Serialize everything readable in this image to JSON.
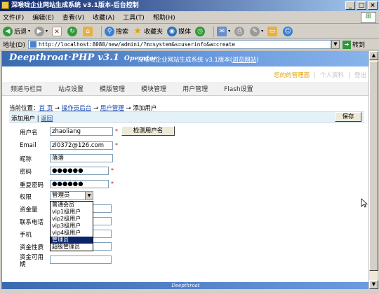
{
  "window": {
    "title": "深喉咙企业网站生成系统 v3.1版本-后台控制"
  },
  "menubar": [
    "文件(F)",
    "编辑(E)",
    "查看(V)",
    "收藏(A)",
    "工具(T)",
    "帮助(H)"
  ],
  "toolbar": {
    "back": "后退",
    "search": "搜索",
    "favorites": "收藏夹",
    "media": "媒体"
  },
  "address": {
    "label": "地址(D)",
    "url": "http://localhost:8080/new/admini/?m=system&s=userinfo&a=create",
    "go": "转到"
  },
  "app": {
    "logo": "Deepthroat·PHP v3.1",
    "logo_suffix": "Operator",
    "subtitle": "深喉咙企业网站生成系统 v3.1版本",
    "browse_site": "浏览网站",
    "user_links": [
      "您的的管理面",
      "个人资料",
      "登出"
    ]
  },
  "nav_tabs": [
    "频道与栏目",
    "站点设置",
    "模版管理",
    "模块管理",
    "用户管理",
    "Flash设置"
  ],
  "breadcrumb": {
    "prefix": "当前位置：",
    "home": "首 页",
    "arrow": "→",
    "backend": "操作员后台",
    "user_mgmt": "用户管理",
    "current": "添加用户"
  },
  "panel": {
    "title": "添加用户",
    "back": "返回",
    "save": "保存"
  },
  "form": {
    "username": {
      "label": "用户名",
      "value": "zhaoliang"
    },
    "check_button": "检测用户名",
    "email": {
      "label": "Email",
      "value": "zl0372@126.com"
    },
    "nickname": {
      "label": "昵称",
      "value": "落落"
    },
    "password": {
      "label": "密码",
      "value": "●●●●●●"
    },
    "repeat_password": {
      "label": "重复密码",
      "value": "●●●●●●"
    },
    "permission": {
      "label": "权限",
      "value": "管理员"
    },
    "capital": {
      "label": "资金量"
    },
    "phone": {
      "label": "联系电话"
    },
    "mobile": {
      "label": "手机"
    },
    "capital_type": {
      "label": "资金性质"
    },
    "capital_period": {
      "label": "资金可用期"
    },
    "required_mark": "*"
  },
  "permission_options": [
    "普通会员",
    "vip1级用户",
    "vip2级用户",
    "vip3级用户",
    "vip4级用户",
    "管理员",
    "超级管理员"
  ],
  "permission_selected_index": 5,
  "footer": "Deepthroat"
}
